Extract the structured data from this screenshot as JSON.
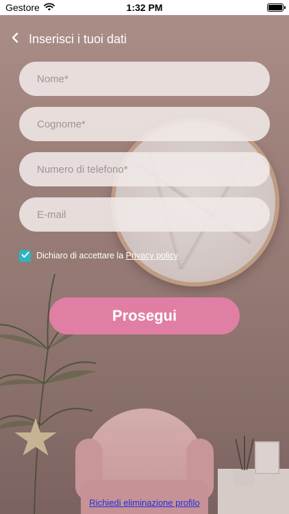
{
  "status_bar": {
    "carrier": "Gestore",
    "time": "1:32 PM",
    "battery_percent": 100
  },
  "header": {
    "title": "Inserisci i tuoi dati"
  },
  "form": {
    "first_name_placeholder": "Nome*",
    "last_name_placeholder": "Cognome*",
    "phone_placeholder": "Numero di telefono*",
    "email_placeholder": "E-mail",
    "consent_text": "Dichiaro di accettare la ",
    "privacy_link": "Privacy policy",
    "consent_checked": true,
    "submit_label": "Prosegui"
  },
  "footer": {
    "delete_profile_link": "Richiedi eliminazione profilo"
  },
  "colors": {
    "accent": "#e07fa3",
    "checkbox": "#2bb5c1",
    "link": "#1a2de8"
  },
  "icons": {
    "wifi": "wifi-icon",
    "battery": "battery-icon",
    "back": "chevron-left-icon",
    "check": "checkmark-icon"
  }
}
